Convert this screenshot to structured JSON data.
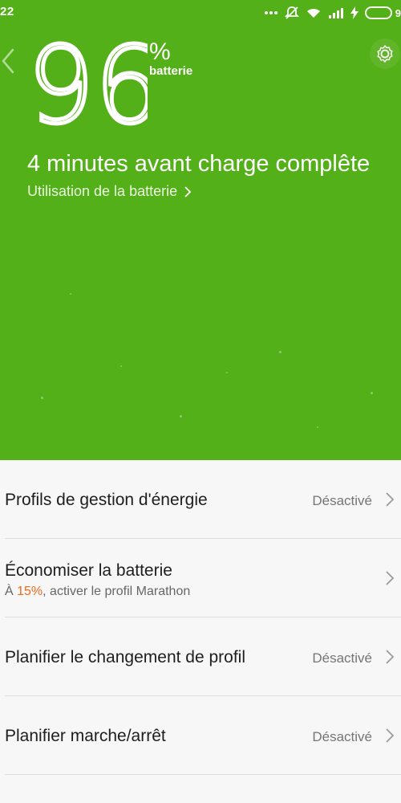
{
  "status_bar": {
    "time": "22",
    "icons": [
      "more-dots-icon",
      "silent-icon",
      "wifi-icon",
      "signal-icon",
      "charging-bolt-icon",
      "battery-icon"
    ],
    "battery_tail": "9"
  },
  "hero": {
    "percent_value": "96",
    "percent_sign": "%",
    "percent_label": "batterie",
    "eta": "4 minutes  avant charge complête",
    "usage_link": "Utilisation de la batterie",
    "background_color": "#54b018"
  },
  "list": {
    "items": [
      {
        "title": "Profils de gestion d'énergie",
        "value": "Désactivé"
      },
      {
        "title": "Économiser la batterie",
        "subtitle_prefix": "À ",
        "subtitle_accent": "15%",
        "subtitle_suffix": ", activer le profil Marathon"
      },
      {
        "title": "Planifier le changement de profil",
        "value": "Désactivé"
      },
      {
        "title": "Planifier marche/arrêt",
        "value": "Désactivé"
      }
    ],
    "accent_color": "#f26a1b"
  }
}
